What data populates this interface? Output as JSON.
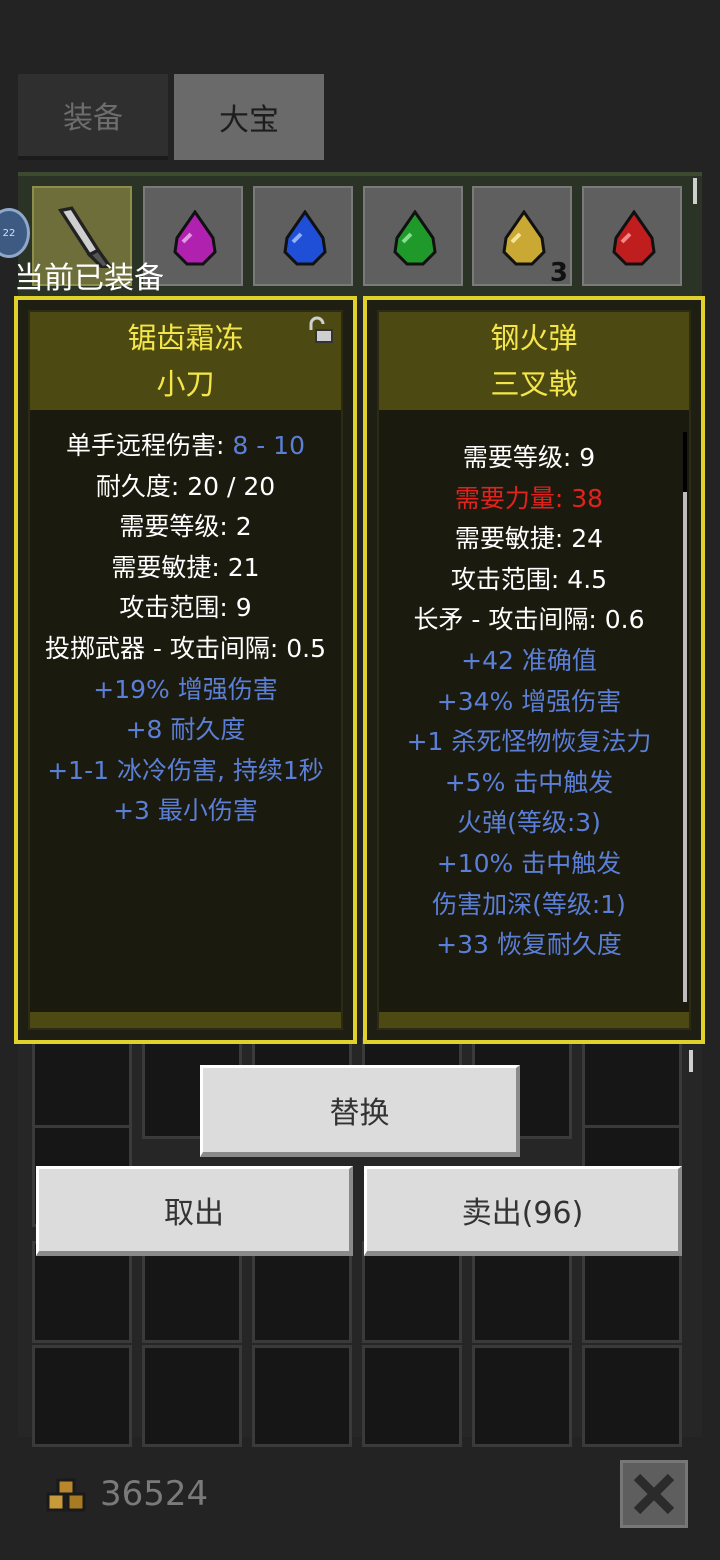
{
  "tabs": [
    {
      "label": "装备",
      "active": false
    },
    {
      "label": "大宝",
      "active": true
    }
  ],
  "inventory": {
    "slots": [
      {
        "icon": "dagger-icon",
        "selected": true
      },
      {
        "icon": "purple-gem-icon",
        "color": "#b021b0"
      },
      {
        "icon": "blue-gem-icon",
        "color": "#1f4fd6"
      },
      {
        "icon": "green-gem-icon",
        "color": "#1f9a2a"
      },
      {
        "icon": "yellow-gem-icon",
        "color": "#c9a934",
        "count": "3"
      },
      {
        "icon": "red-gem-icon",
        "color": "#c01e1e"
      }
    ]
  },
  "equipped_label": "当前已装备",
  "left_item": {
    "name_line1": "锯齿霜冻",
    "name_line2": "小刀",
    "damage_label": "单手远程伤害: ",
    "damage_value": "8 - 10",
    "stats": [
      {
        "text": "耐久度: 20 / 20",
        "style": "w"
      },
      {
        "text": "需要等级: 2",
        "style": "w"
      },
      {
        "text": "需要敏捷: 21",
        "style": "w"
      },
      {
        "text": "攻击范围: 9",
        "style": "w"
      },
      {
        "text": "投掷武器 - 攻击间隔: 0.5",
        "style": "w"
      },
      {
        "text": "+19% 增强伤害",
        "style": "b"
      },
      {
        "text": "+8 耐久度",
        "style": "b"
      },
      {
        "text": "+1-1 冰冷伤害, 持续1秒",
        "style": "b"
      },
      {
        "text": "+3 最小伤害",
        "style": "b"
      }
    ]
  },
  "right_item": {
    "name_line1": "钢火弹",
    "name_line2": "三叉戟",
    "stats": [
      {
        "text": "需要等级: 9",
        "style": "w"
      },
      {
        "text": "需要力量: 38",
        "style": "r"
      },
      {
        "text": "需要敏捷: 24",
        "style": "w"
      },
      {
        "text": "攻击范围: 4.5",
        "style": "w"
      },
      {
        "text": "长矛 - 攻击间隔: 0.6",
        "style": "w"
      },
      {
        "text": "+42 准确值",
        "style": "b"
      },
      {
        "text": "+34% 增强伤害",
        "style": "b"
      },
      {
        "text": "+1 杀死怪物恢复法力",
        "style": "b"
      },
      {
        "text": "+5% 击中触发",
        "style": "b"
      },
      {
        "text": "火弹(等级:3)",
        "style": "b"
      },
      {
        "text": "+10% 击中触发",
        "style": "b"
      },
      {
        "text": "伤害加深(等级:1)",
        "style": "b"
      },
      {
        "text": "+33 恢复耐久度",
        "style": "b"
      }
    ]
  },
  "buttons": {
    "replace": "替换",
    "take_out": "取出",
    "sell": "卖出(96)"
  },
  "footer": {
    "gold_amount": "36524"
  },
  "colors": {
    "panel_border": "#e0d22a",
    "item_name": "#f4e64a",
    "magic_stat": "#5b7fd6",
    "requirement_unmet": "#e0231f"
  }
}
